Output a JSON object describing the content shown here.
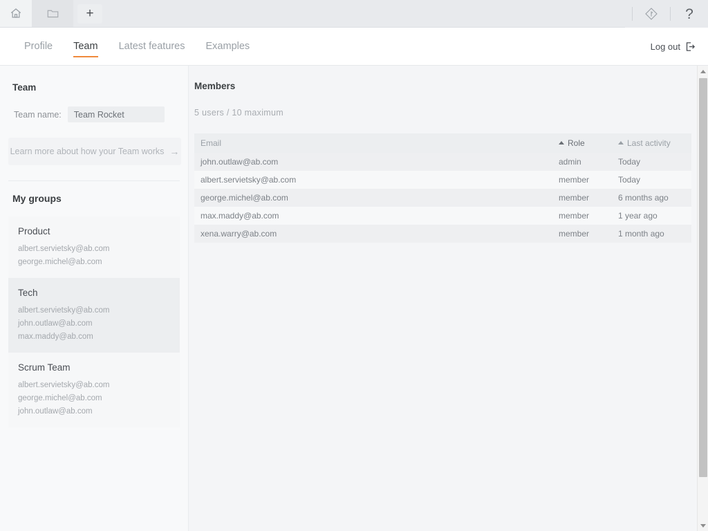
{
  "theme": {
    "accent": "#f08a3c",
    "header_bg": "#ffffff",
    "sidebar_bg": "#f8f9fa",
    "main_bg": "#f4f5f7",
    "table_header_bg": "#eceef0",
    "row_odd_bg": "#eeeff1",
    "row_even_bg": "#f7f8f9"
  },
  "browser": {
    "home_icon": "home-icon",
    "tab_icon": "folder-tab-icon",
    "new_tab_label": "+",
    "extension_icon": "diamond-badge-icon",
    "help_label": "?"
  },
  "header": {
    "tabs": [
      {
        "label": "Profile",
        "active": false
      },
      {
        "label": "Team",
        "active": true
      },
      {
        "label": "Latest features",
        "active": false
      },
      {
        "label": "Examples",
        "active": false
      }
    ],
    "logout_label": "Log out",
    "logout_icon": "sign-out-icon"
  },
  "sidebar": {
    "title": "Team",
    "team_name_label": "Team name:",
    "team_name_value": "Team Rocket",
    "team_name_placeholder": "Team name",
    "learn_more_label": "Learn more about how your Team works",
    "learn_more_arrow": "→",
    "groups_title": "My groups",
    "groups": [
      {
        "name": "Product",
        "members": [
          "albert.servietsky@ab.com",
          "george.michel@ab.com"
        ]
      },
      {
        "name": "Tech",
        "members": [
          "albert.servietsky@ab.com",
          "john.outlaw@ab.com",
          "max.maddy@ab.com"
        ]
      },
      {
        "name": "Scrum Team",
        "members": [
          "albert.servietsky@ab.com",
          "george.michel@ab.com",
          "john.outlaw@ab.com"
        ]
      }
    ]
  },
  "main": {
    "title": "Members",
    "user_count": "5 users / 10 maximum",
    "table": {
      "columns": [
        {
          "label": "Email",
          "sortable": false,
          "sorted": false
        },
        {
          "label": "Role",
          "sortable": true,
          "sorted": true
        },
        {
          "label": "Last activity",
          "sortable": true,
          "sorted": false
        }
      ],
      "rows": [
        {
          "email": "john.outlaw@ab.com",
          "role": "admin",
          "last_activity": "Today"
        },
        {
          "email": "albert.servietsky@ab.com",
          "role": "member",
          "last_activity": "Today"
        },
        {
          "email": "george.michel@ab.com",
          "role": "member",
          "last_activity": "6 months ago"
        },
        {
          "email": "max.maddy@ab.com",
          "role": "member",
          "last_activity": "1 year ago"
        },
        {
          "email": "xena.warry@ab.com",
          "role": "member",
          "last_activity": "1 month ago"
        }
      ]
    }
  }
}
